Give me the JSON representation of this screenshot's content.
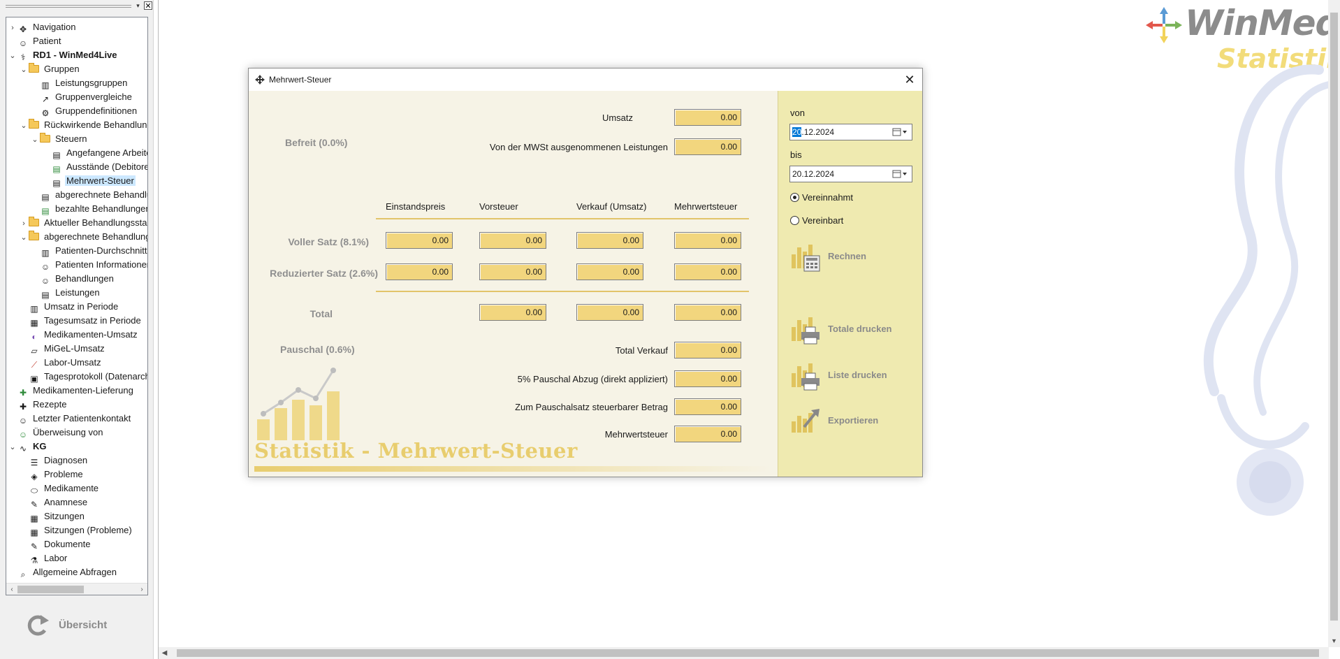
{
  "left_panel": {
    "tree": [
      {
        "label": "Navigation",
        "level": 0,
        "toggle": "collapsed",
        "icon": "navigation-icon"
      },
      {
        "label": "Patient",
        "level": 0,
        "toggle": "none",
        "icon": "person-icon"
      },
      {
        "label": "RD1 - WinMed4Live",
        "level": 0,
        "toggle": "expanded",
        "icon": "stethoscope-icon",
        "bold": true
      },
      {
        "label": "Gruppen",
        "level": 1,
        "toggle": "expanded",
        "icon": "folder-icon"
      },
      {
        "label": "Leistungsgruppen",
        "level": 2,
        "toggle": "none",
        "icon": "bar-chart-icon"
      },
      {
        "label": "Gruppenvergleiche",
        "level": 2,
        "toggle": "none",
        "icon": "line-chart-icon"
      },
      {
        "label": "Gruppendefinitionen",
        "level": 2,
        "toggle": "none",
        "icon": "gear-icon"
      },
      {
        "label": "Rückwirkende Behandlungen",
        "level": 1,
        "toggle": "expanded",
        "icon": "folder-icon"
      },
      {
        "label": "Steuern",
        "level": 2,
        "toggle": "expanded",
        "icon": "folder-icon"
      },
      {
        "label": "Angefangene Arbeiten",
        "level": 3,
        "toggle": "none",
        "icon": "report-icon"
      },
      {
        "label": "Ausstände (Debitoren)",
        "level": 3,
        "toggle": "none",
        "icon": "report-plus-icon"
      },
      {
        "label": "Mehrwert-Steuer",
        "level": 3,
        "toggle": "none",
        "icon": "report-icon",
        "selected": true
      },
      {
        "label": "abgerechnete Behandlungen",
        "level": 2,
        "toggle": "none",
        "icon": "report-icon"
      },
      {
        "label": "bezahlte Behandlungen",
        "level": 2,
        "toggle": "none",
        "icon": "report-check-icon"
      },
      {
        "label": "Aktueller Behandlungsstand",
        "level": 1,
        "toggle": "collapsed",
        "icon": "folder-icon"
      },
      {
        "label": "abgerechnete Behandlungen",
        "level": 1,
        "toggle": "expanded",
        "icon": "folder-icon"
      },
      {
        "label": "Patienten-Durchschnitt",
        "level": 2,
        "toggle": "none",
        "icon": "bar-chart-icon"
      },
      {
        "label": "Patienten Informationen",
        "level": 2,
        "toggle": "none",
        "icon": "person-icon"
      },
      {
        "label": "Behandlungen",
        "level": 2,
        "toggle": "none",
        "icon": "person-icon"
      },
      {
        "label": "Leistungen",
        "level": 2,
        "toggle": "none",
        "icon": "report-icon"
      },
      {
        "label": "Umsatz in Periode",
        "level": 1,
        "toggle": "none",
        "icon": "bar-chart-icon"
      },
      {
        "label": "Tagesumsatz in Periode",
        "level": 1,
        "toggle": "none",
        "icon": "calendar-icon"
      },
      {
        "label": "Medikamenten-Umsatz",
        "level": 1,
        "toggle": "none",
        "icon": "pill-icon"
      },
      {
        "label": "MiGeL-Umsatz",
        "level": 1,
        "toggle": "none",
        "icon": "bandage-icon"
      },
      {
        "label": "Labor-Umsatz",
        "level": 1,
        "toggle": "none",
        "icon": "test-tube-icon"
      },
      {
        "label": "Tagesprotokoll (Datenarchiv)",
        "level": 1,
        "toggle": "none",
        "icon": "calendar-day-icon"
      },
      {
        "label": "Medikamenten-Lieferung",
        "level": 0,
        "toggle": "none",
        "icon": "delivery-icon"
      },
      {
        "label": "Rezepte",
        "level": 0,
        "toggle": "none",
        "icon": "plus-cross-icon"
      },
      {
        "label": "Letzter Patientenkontakt",
        "level": 0,
        "toggle": "none",
        "icon": "person-icon"
      },
      {
        "label": "Überweisung von",
        "level": 0,
        "toggle": "none",
        "icon": "person-plus-icon"
      },
      {
        "label": "KG",
        "level": 0,
        "toggle": "expanded",
        "icon": "pulse-icon",
        "bold": true
      },
      {
        "label": "Diagnosen",
        "level": 1,
        "toggle": "none",
        "icon": "list-icon"
      },
      {
        "label": "Probleme",
        "level": 1,
        "toggle": "none",
        "icon": "cube-icon"
      },
      {
        "label": "Medikamente",
        "level": 1,
        "toggle": "none",
        "icon": "pill-outline-icon"
      },
      {
        "label": "Anamnese",
        "level": 1,
        "toggle": "none",
        "icon": "pen-icon"
      },
      {
        "label": "Sitzungen",
        "level": 1,
        "toggle": "none",
        "icon": "calendar-icon"
      },
      {
        "label": "Sitzungen (Probleme)",
        "level": 1,
        "toggle": "none",
        "icon": "calendar-icon"
      },
      {
        "label": "Dokumente",
        "level": 1,
        "toggle": "none",
        "icon": "document-edit-icon"
      },
      {
        "label": "Labor",
        "level": 1,
        "toggle": "none",
        "icon": "flask-icon"
      },
      {
        "label": "Allgemeine Abfragen",
        "level": 0,
        "toggle": "none",
        "icon": "query-icon"
      }
    ],
    "overview_label": "Übersicht"
  },
  "logo": {
    "title": "WinMed",
    "subtitle": "Statistik"
  },
  "dialog": {
    "title": "Mehrwert-Steuer",
    "befreit": {
      "section": "Befreit (0.0%)",
      "umsatz_label": "Umsatz",
      "umsatz_value": "0.00",
      "ausgenommen_label": "Von der MWSt ausgenommenen Leistungen",
      "ausgenommen_value": "0.00"
    },
    "columns": [
      "Einstandspreis",
      "Vorsteuer",
      "Verkauf (Umsatz)",
      "Mehrwertsteuer"
    ],
    "rows": [
      {
        "label": "Voller Satz (8.1%)",
        "values": [
          "0.00",
          "0.00",
          "0.00",
          "0.00"
        ]
      },
      {
        "label": "Reduzierter Satz (2.6%)",
        "values": [
          "0.00",
          "0.00",
          "0.00",
          "0.00"
        ]
      }
    ],
    "total": {
      "label": "Total",
      "values": [
        "0.00",
        "0.00",
        "0.00"
      ]
    },
    "pauschal": {
      "section": "Pauschal (0.6%)",
      "items": [
        {
          "label": "Total Verkauf",
          "value": "0.00"
        },
        {
          "label": "5% Pauschal Abzug (direkt appliziert)",
          "value": "0.00"
        },
        {
          "label": "Zum Pauschalsatz steuerbarer Betrag",
          "value": "0.00"
        },
        {
          "label": "Mehrwertsteuer",
          "value": "0.00"
        }
      ]
    },
    "watermark": "Statistik - Mehrwert-Steuer",
    "side": {
      "von_label": "von",
      "von_value_selected": "20",
      "von_value_rest": ".12.2024",
      "bis_label": "bis",
      "bis_value": "20.12.2024",
      "radio_options": [
        {
          "label": "Vereinnahmt",
          "selected": true
        },
        {
          "label": "Vereinbart",
          "selected": false
        }
      ],
      "buttons": {
        "rechnen": "Rechnen",
        "totale_drucken": "Totale drucken",
        "liste_drucken": "Liste drucken",
        "exportieren": "Exportieren"
      }
    }
  },
  "colors": {
    "field_bg": "#f2d67e",
    "side_bg": "#efeab0",
    "body_bg": "#f6f3e6",
    "accent_gold": "#e2c46a",
    "selection": "#cce8ff"
  }
}
